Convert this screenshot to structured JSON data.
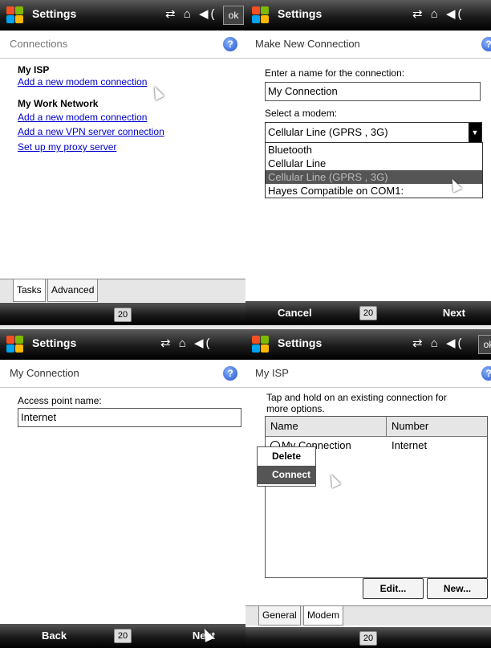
{
  "panel1": {
    "app_title": "Settings",
    "status_icons": "⇄ ⌂ ◀(",
    "ok": "ok",
    "header": "Connections",
    "sections": [
      {
        "title": "My ISP",
        "links": [
          "Add a new modem connection"
        ]
      },
      {
        "title": "My Work Network",
        "links": [
          "Add a new modem connection",
          "Add a new VPN server connection",
          "Set up my proxy server"
        ]
      }
    ],
    "tabs": [
      "Tasks",
      "Advanced"
    ],
    "kbd": "20"
  },
  "panel2": {
    "app_title": "Settings",
    "status_icons": "⇄ ⌂ ◀(",
    "header": "Make New Connection",
    "name_label": "Enter a name for the connection:",
    "name_value": "My Connection",
    "modem_label": "Select a modem:",
    "modem_value": "Cellular Line (GPRS , 3G)",
    "modem_options": [
      "Bluetooth",
      "Cellular Line",
      "Cellular Line (GPRS , 3G)",
      "Hayes Compatible on COM1:"
    ],
    "left_softkey": "Cancel",
    "right_softkey": "Next",
    "kbd": "20"
  },
  "panel3": {
    "app_title": "Settings",
    "status_icons": "⇄ ⌂ ◀(",
    "header": "My Connection",
    "apn_label": "Access point name:",
    "apn_value": "Internet",
    "left_softkey": "Back",
    "right_softkey": "Next",
    "kbd": "20"
  },
  "panel4": {
    "app_title": "Settings",
    "status_icons": "⇄ ⌂ ◀(",
    "ok": "ok",
    "header": "My ISP",
    "instructions_line1": "Tap and hold on an existing connection for",
    "instructions_line2": "more options.",
    "col_name": "Name",
    "col_number": "Number",
    "row_name": "My Connection",
    "row_number": "Internet",
    "ctx_items": [
      "Delete",
      "Connect"
    ],
    "edit_btn": "Edit...",
    "new_btn": "New...",
    "tabs": [
      "General",
      "Modem"
    ],
    "kbd": "20"
  }
}
